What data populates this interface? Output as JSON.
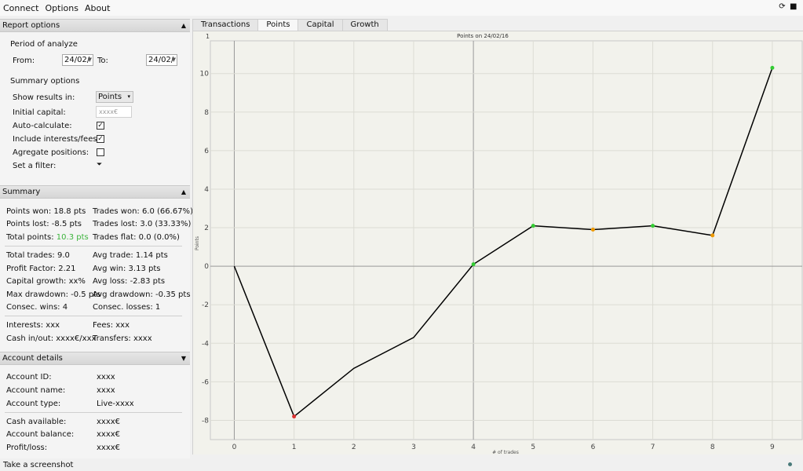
{
  "menu": {
    "items": [
      "Connect",
      "Options",
      "About"
    ]
  },
  "report_options": {
    "title": "Report options",
    "period_label": "Period of analyze",
    "from_label": "From:",
    "from_value": "24/02/",
    "to_label": "To:",
    "to_value": "24/02/",
    "summary_options_label": "Summary options",
    "show_results_label": "Show results in:",
    "show_results_value": "Points",
    "initial_capital_label": "Initial capital:",
    "initial_capital_placeholder": "xxxx€",
    "auto_calc_label": "Auto-calculate:",
    "interests_label": "Include interests/fees:",
    "aggregate_label": "Agregate positions:",
    "filter_label": "Set a filter:",
    "checks": {
      "auto_calc": true,
      "interests": true,
      "aggregate": false
    }
  },
  "summary": {
    "title": "Summary",
    "points_won": "Points won: 18.8 pts",
    "points_lost": "Points lost: -8.5 pts",
    "total_points_label": "Total points: ",
    "total_points_value": "10.3 pts",
    "trades_won": "Trades won: 6.0 (66.67%)",
    "trades_lost": "Trades lost: 3.0 (33.33%)",
    "trades_flat": "Trades flat: 0.0 (0.0%)",
    "total_trades": "Total trades: 9.0",
    "profit_factor": "Profit Factor: 2.21",
    "capital_growth": "Capital growth: xx%",
    "max_drawdown": "Max drawdown: -0.5 pts",
    "consec_wins": "Consec. wins: 4",
    "avg_trade": "Avg trade: 1.14 pts",
    "avg_win": "Avg win: 3.13 pts",
    "avg_loss": "Avg loss: -2.83 pts",
    "avg_drawdown": "Avg drawdown: -0.35 pts",
    "consec_losses": "Consec. losses: 1",
    "interests": "Interests: xxx",
    "fees": "Fees: xxx",
    "cash_in_out": "Cash in/out: xxxx€/xxx",
    "transfers": "Transfers: xxxx",
    "total_points_color": "#3cb43c"
  },
  "account": {
    "title": "Account details",
    "rows": [
      {
        "label": "Account ID:",
        "value": "xxxx"
      },
      {
        "label": "Account name:",
        "value": "xxxx"
      },
      {
        "label": "Account type:",
        "value": "Live-xxxx"
      },
      {
        "label": "Cash available:",
        "value": "xxxx€"
      },
      {
        "label": "Account balance:",
        "value": "xxxx€"
      },
      {
        "label": "Profit/loss:",
        "value": "xxxx€"
      }
    ]
  },
  "tabs": [
    "Transactions",
    "Points",
    "Capital",
    "Growth"
  ],
  "active_tab": "Points",
  "status": {
    "screenshot_link": "Take a screenshot"
  },
  "chart_data": {
    "type": "line",
    "title": "Points on 24/02/16",
    "xlabel": "# of trades",
    "ylabel": "Points",
    "x": [
      0,
      1,
      2,
      3,
      4,
      5,
      6,
      7,
      8,
      9
    ],
    "y": [
      0,
      -7.8,
      -5.3,
      -3.7,
      0.1,
      2.1,
      1.9,
      2.1,
      1.6,
      10.3
    ],
    "marker_colors": [
      null,
      "#d33",
      null,
      null,
      "#3c3",
      "#3c3",
      "#e90",
      "#3c3",
      "#e90",
      "#3c3"
    ],
    "x_ticks": [
      0,
      1,
      2,
      3,
      4,
      5,
      6,
      7,
      8,
      9
    ],
    "y_ticks": [
      -8,
      -6,
      -4,
      -2,
      0,
      2,
      4,
      6,
      8,
      10
    ],
    "xlim": [
      -0.4,
      9.5
    ],
    "ylim": [
      -9,
      11.7
    ],
    "corner_label": "1",
    "grid": true,
    "line_color": "#000000"
  }
}
